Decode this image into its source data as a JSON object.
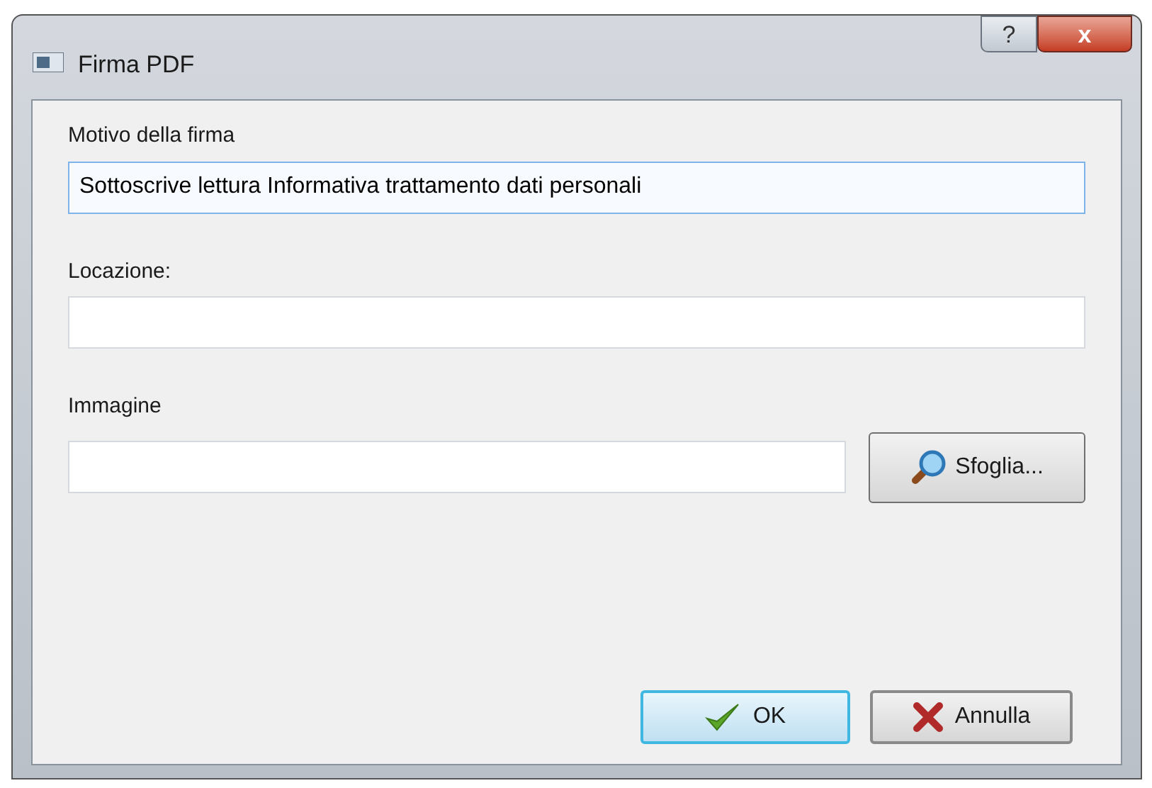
{
  "window": {
    "title": "Firma PDF",
    "buttons": [
      {
        "kind": "help",
        "label": "?"
      },
      {
        "kind": "close",
        "label": "x"
      }
    ]
  },
  "fields": [
    {
      "label": "Motivo della firma",
      "value": "Sottoscrive lettura Informativa trattamento dati personali",
      "focused": true
    },
    {
      "label": "Locazione:",
      "focused": false
    },
    {
      "label": "Immagine",
      "focused": false
    }
  ],
  "browse_button": {
    "label": "Sfoglia..."
  },
  "buttons": [
    {
      "kind": "ok",
      "label": "OK",
      "default": true
    },
    {
      "kind": "cancel",
      "label": "Annulla",
      "default": false
    }
  ]
}
